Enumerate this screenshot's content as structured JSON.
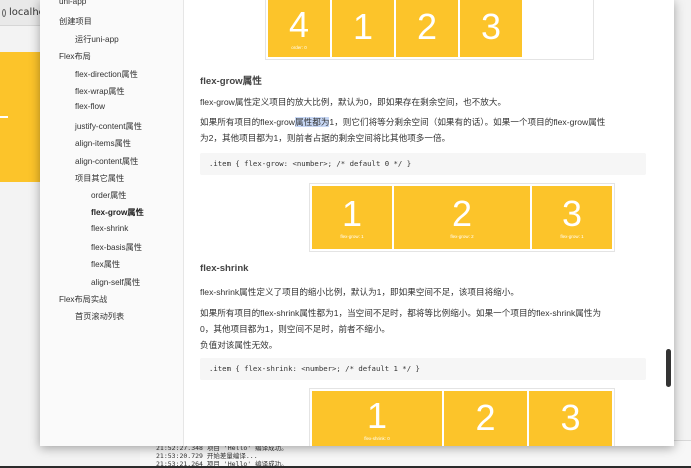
{
  "background": {
    "tab_label": "localhos",
    "console_lines": [
      "21:52:27.348 项目 'Hello' 编译成功。",
      "21:53:20.729 开始差量编译...",
      "21:53:21.264 项目 'Hello' 编译成功。"
    ]
  },
  "sidebar": {
    "items": [
      {
        "label": "uni-app"
      },
      {
        "label": "创建项目"
      },
      {
        "label": "运行uni-app"
      },
      {
        "label": "Flex布局"
      },
      {
        "label": "flex-direction属性"
      },
      {
        "label": "flex-wrap属性"
      },
      {
        "label": "flex-flow"
      },
      {
        "label": "justify-content属性"
      },
      {
        "label": "align-items属性"
      },
      {
        "label": "align-content属性"
      },
      {
        "label": "项目其它属性"
      },
      {
        "label": "order属性"
      },
      {
        "label": "flex-grow属性"
      },
      {
        "label": "flex-shrink"
      },
      {
        "label": "flex-basis属性"
      },
      {
        "label": "flex属性"
      },
      {
        "label": "align-self属性"
      },
      {
        "label": "Flex布局实战"
      },
      {
        "label": "首页滚动列表"
      }
    ]
  },
  "content": {
    "top_demo": [
      {
        "num": "4",
        "sub": "order: 0"
      },
      {
        "num": "1",
        "sub": ""
      },
      {
        "num": "2",
        "sub": ""
      },
      {
        "num": "3",
        "sub": ""
      }
    ],
    "grow_heading": "flex-grow属性",
    "grow_p1": "flex-grow属性定义项目的放大比例，默认为0，即如果存在剩余空间，也不放大。",
    "grow_p2_pre": "如果所有项目的flex-grow",
    "grow_p2_hl": "属性都为",
    "grow_p2_post": "1，则它们将等分剩余空间（如果有的话）。如果一个项目的flex-grow属性",
    "grow_p2_line2": "为2，其他项目都为1，则前者占据的剩余空间将比其他项多一倍。",
    "grow_code": ".item { flex-grow: <number>; /* default 0 */ }",
    "grow_demo": [
      {
        "num": "1",
        "sub": "flex-grow: 1"
      },
      {
        "num": "2",
        "sub": "flex-grow: 2"
      },
      {
        "num": "3",
        "sub": "flex-grow: 1"
      }
    ],
    "shrink_heading": "flex-shrink",
    "shrink_p1": "flex-shrink属性定义了项目的缩小比例，默认为1，即如果空间不足，该项目将缩小。",
    "shrink_p2_line1": "如果所有项目的flex-shrink属性都为1，当空间不足时，都将等比例缩小。如果一个项目的flex-shrink属性为",
    "shrink_p2_line2": "0，其他项目都为1，则空间不足时，前者不缩小。",
    "shrink_p2_line3": "负值对该属性无效。",
    "shrink_code": ".item { flex-shrink: <number>; /* default 1 */ }",
    "shrink_demo": [
      {
        "num": "1",
        "sub": "flex-shrink: 0"
      },
      {
        "num": "2",
        "sub": ""
      },
      {
        "num": "3",
        "sub": ""
      }
    ]
  },
  "colors": {
    "accent": "#fcc42a",
    "highlight": "#c7d7f4"
  }
}
